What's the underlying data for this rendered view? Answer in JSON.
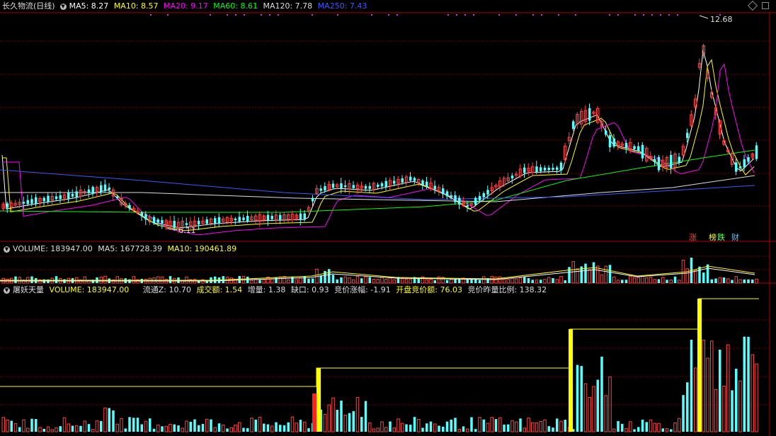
{
  "header": {
    "stock_title": "长久物流(日线)",
    "ma": [
      {
        "label": "MA5: 8.27",
        "color": "#ffffff"
      },
      {
        "label": "MA10: 8.57",
        "color": "#ffff00"
      },
      {
        "label": "MA20: 9.17",
        "color": "#ff00ff"
      },
      {
        "label": "MA60: 8.61",
        "color": "#00ff00"
      },
      {
        "label": "MA120: 7.78",
        "color": "#dddddd"
      },
      {
        "label": "MA250: 7.43",
        "color": "#3a5aff"
      }
    ]
  },
  "price_panel": {
    "high_label": "12.68",
    "low_label": "6.11",
    "badges": [
      {
        "text": "涨",
        "color": "#ff4040"
      },
      {
        "text": "榜",
        "color": "#ffff00"
      },
      {
        "text": "跌",
        "color": "#60ff60"
      },
      {
        "text": "财",
        "color": "#60c0ff"
      }
    ]
  },
  "volume_panel": {
    "items": [
      {
        "label": "VOLUME: 183947.00",
        "color": "#dddddd"
      },
      {
        "label": "MA5: 167728.39",
        "color": "#dddddd"
      },
      {
        "label": "MA10: 190461.89",
        "color": "#ffff00"
      }
    ]
  },
  "indicator_panel": {
    "items": [
      {
        "label": "屠妖天量",
        "color": "#dddddd"
      },
      {
        "label": "VOLUME: 183947.00",
        "color": "#ffff00"
      },
      {
        "label": "流通Z: 10.70",
        "color": "#dddddd"
      },
      {
        "label": "成交额: 1.54",
        "color": "#ffff00"
      },
      {
        "label": "增量: 1.38",
        "color": "#dddddd"
      },
      {
        "label": "缺口: 0.93",
        "color": "#dddddd"
      },
      {
        "label": "竞价涨幅: -1.91",
        "color": "#dddddd"
      },
      {
        "label": "开盘竞价额: 76.03",
        "color": "#ffff00"
      },
      {
        "label": "竞价昨量比例: 138.32",
        "color": "#dddddd"
      }
    ]
  },
  "colors": {
    "up": "#ff4444",
    "down": "#54ffff",
    "grid": "#8b0000",
    "background": "#000000"
  }
}
